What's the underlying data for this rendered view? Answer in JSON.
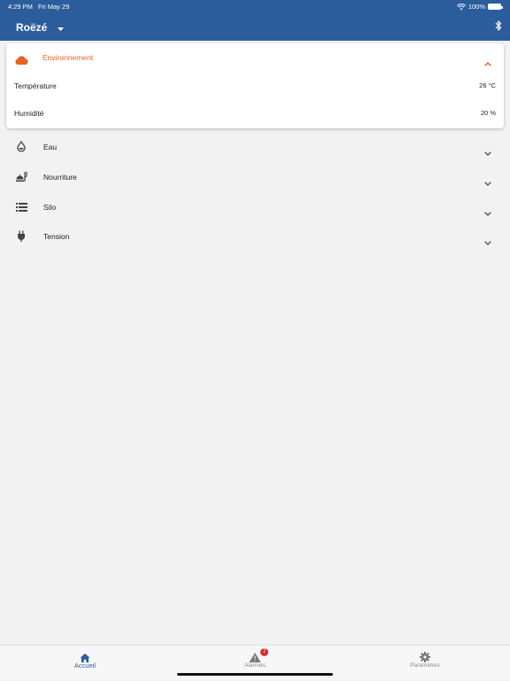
{
  "status_bar": {
    "time": "4:29 PM",
    "date": "Fri May 29",
    "battery": "100%"
  },
  "header": {
    "title": "Roëzé"
  },
  "environment": {
    "label": "Environnement",
    "accent_color": "#e8621f",
    "rows": [
      {
        "name": "Température",
        "value": "26 °C"
      },
      {
        "name": "Humidité",
        "value": "20 %"
      }
    ]
  },
  "sections": [
    {
      "label": "Eau",
      "icon": "water-drop-icon"
    },
    {
      "label": "Nourriture",
      "icon": "food-icon"
    },
    {
      "label": "Silo",
      "icon": "silo-icon"
    },
    {
      "label": "Tension",
      "icon": "plug-icon"
    }
  ],
  "tabs": [
    {
      "label": "Accueil",
      "icon": "home-icon",
      "active": true
    },
    {
      "label": "Alarmes",
      "icon": "warning-icon",
      "badge": "7"
    },
    {
      "label": "Paramètres",
      "icon": "gear-icon"
    }
  ],
  "colors": {
    "primary": "#2b5d9c",
    "accent": "#e8621f",
    "badge": "#d9302f"
  }
}
